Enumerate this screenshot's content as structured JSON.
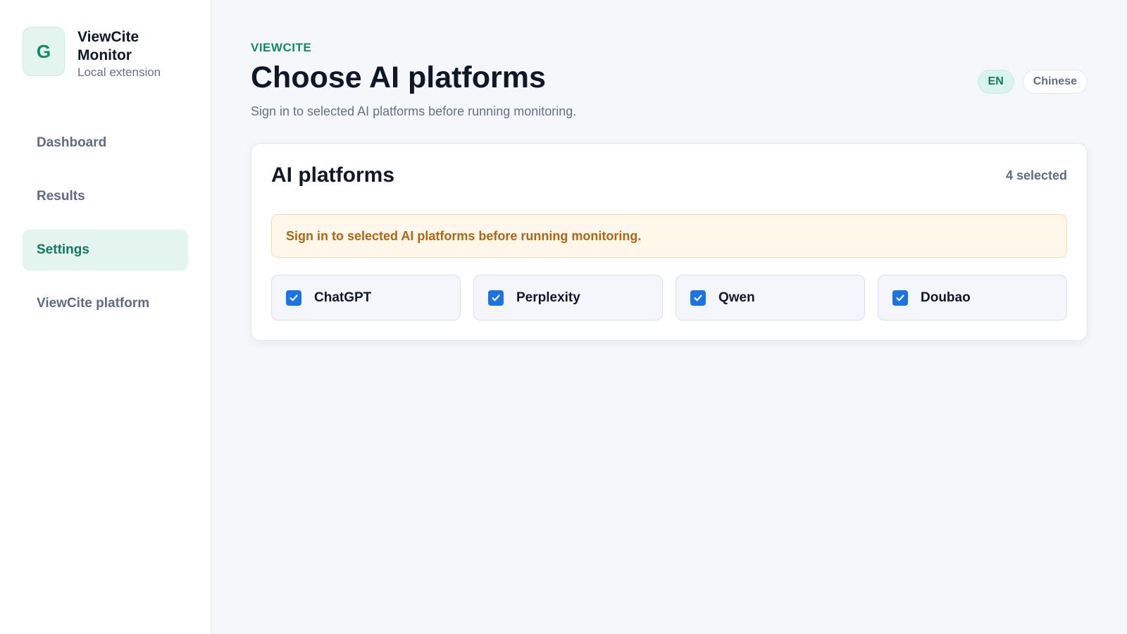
{
  "brand": {
    "logo_letter": "G",
    "name": "ViewCite Monitor",
    "subtitle": "Local extension"
  },
  "nav": {
    "items": [
      {
        "label": "Dashboard",
        "active": false
      },
      {
        "label": "Results",
        "active": false
      },
      {
        "label": "Settings",
        "active": true
      },
      {
        "label": "ViewCite platform",
        "active": false
      }
    ]
  },
  "header": {
    "eyebrow": "VIEWCITE",
    "title": "Choose AI platforms",
    "subtitle": "Sign in to selected AI platforms before running monitoring."
  },
  "language": {
    "options": [
      {
        "label": "EN",
        "active": true
      },
      {
        "label": "Chinese",
        "active": false
      }
    ]
  },
  "card": {
    "title": "AI platforms",
    "count_label": "4 selected",
    "notice": "Sign in to selected AI platforms before running monitoring.",
    "platforms": [
      {
        "name": "ChatGPT",
        "checked": true
      },
      {
        "name": "Perplexity",
        "checked": true
      },
      {
        "name": "Qwen",
        "checked": true
      },
      {
        "name": "Doubao",
        "checked": true
      }
    ]
  },
  "colors": {
    "accent": "#0f8a6b",
    "checkbox": "#1a73e8",
    "notice_text": "#b4650e",
    "notice_bg": "#fff7ea"
  }
}
